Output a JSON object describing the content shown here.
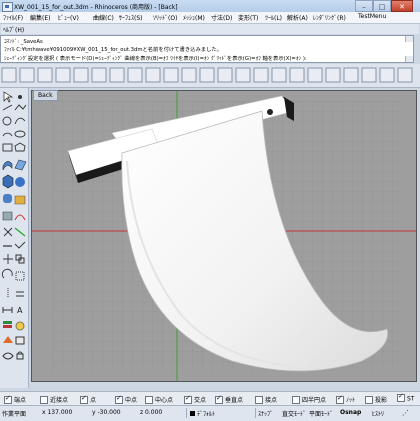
{
  "window": {
    "title": "XW_001_15_for_out.3dm - Rhinoceros (商用版) - [Back]",
    "min": "–",
    "max": "□",
    "close": "✕"
  },
  "menu": [
    "ﾌｧｲﾙ(F)",
    "編集(E)",
    "ﾋﾞｭｰ(V)",
    "曲線(C)",
    "ｻｰﾌｪｽ(S)",
    "ｿﾘｯﾄﾞ(O)",
    "ﾒｯｼｭ(M)",
    "寸法(D)",
    "変形(T)",
    "ﾂｰﾙ(L)",
    "解析(A)",
    "ﾚﾝﾀﾞﾘﾝｸﾞ(R)",
    "TestMenu",
    "ﾍﾙﾌﾟ(H)"
  ],
  "command_history": [
    "ｺﾏﾝﾄﾞ: _SaveAs",
    "ﾌｧｲﾙ C:¥tmhwave¥091009¥XW_001_15_for_out.3dmと名前を付けて書き込みました。",
    "ｼｪｰﾃﾞｨﾝｸﾞ設定を選択 ( 表示モード(D)=ｼｪｰﾃﾞｨﾝｸﾞ 曲線を表示(B)=ｵﾌ ﾜｲﾔを表示(I)=ｵﾝ ｸﾞﾘｯﾄﾞを表示(G)=ｵﾌ 軸を表示(X)=ｵﾝ ):"
  ],
  "viewport": {
    "label": "Back"
  },
  "left_tools": [
    "pointer-arrow-icon",
    "point-icon",
    "line-icon",
    "polyline-icon",
    "circle-icon",
    "curve-icon",
    "arc-icon",
    "ellipse-icon",
    "rectangle-icon",
    "polygon-icon",
    "surface-icon",
    "extrude-icon",
    "box-icon",
    "sphere-icon",
    "cylinder-icon",
    "boolean-icon",
    "mesh-icon",
    "fillet-icon",
    "trim-icon",
    "split-icon",
    "join-icon",
    "explode-icon",
    "move-icon",
    "copy-icon",
    "rotate-icon",
    "scale-icon",
    "mirror-icon",
    "array-icon",
    "dimension-icon",
    "text-icon",
    "layer-icon",
    "render-icon",
    "analyze-icon",
    "properties-icon",
    "hide-icon",
    "lock-icon"
  ],
  "osnaps": [
    {
      "label": "端点",
      "checked": true
    },
    {
      "label": "近接点",
      "checked": false
    },
    {
      "label": "点",
      "checked": true
    },
    {
      "label": "中点",
      "checked": true
    },
    {
      "label": "中心点",
      "checked": false
    },
    {
      "label": "交点",
      "checked": true
    },
    {
      "label": "垂直点",
      "checked": true
    },
    {
      "label": "接点",
      "checked": false
    },
    {
      "label": "四半円点",
      "checked": false
    },
    {
      "label": "ﾉｯﾄ",
      "checked": true
    },
    {
      "label": "投影",
      "checked": false
    },
    {
      "label": "ST",
      "checked": true
    }
  ],
  "status": {
    "cplane": "作業平面",
    "x": "x 137.000",
    "y": "y -30.000",
    "z": "z 0.000",
    "layer": "ﾃﾞﾌｫﾙﾄ",
    "snap": "ｽﾅｯﾌﾟ",
    "ortho": "直交ﾓｰﾄﾞ",
    "planar": "平面ﾓｰﾄﾞ",
    "osnap": "Osnap",
    "history": "ﾋｽﾄﾘ"
  },
  "colors": {
    "viewport_bg": "#9c9c9c",
    "grid": "#8a8a8a",
    "axis_red": "#c03030",
    "axis_green": "#30a030",
    "model_white": "#f7f7f7",
    "model_dark": "#1a1a1a"
  }
}
